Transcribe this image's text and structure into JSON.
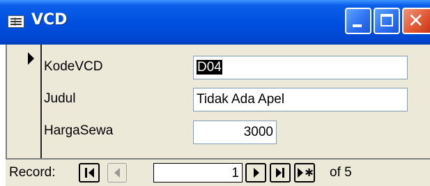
{
  "window": {
    "title": "VCD",
    "controls": {
      "minimize": "minimize",
      "maximize": "maximize",
      "close": "close"
    }
  },
  "form": {
    "fields": [
      {
        "label": "KodeVCD",
        "value": "D04"
      },
      {
        "label": "Judul",
        "value": "Tidak Ada Apel"
      },
      {
        "label": "HargaSewa",
        "value": "3000"
      }
    ]
  },
  "navigator": {
    "label": "Record:",
    "current": "1",
    "total_text": "of 5"
  }
}
